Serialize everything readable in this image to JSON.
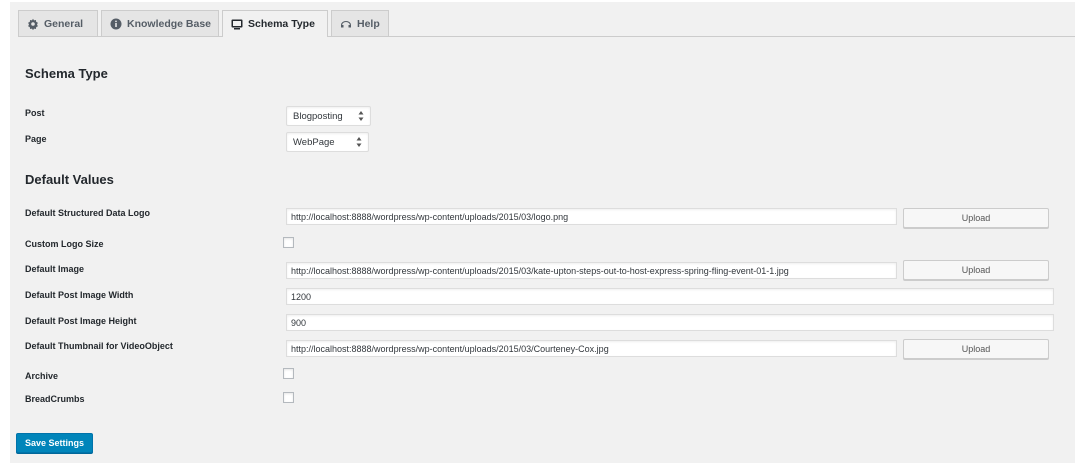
{
  "tabs": [
    {
      "label": "General",
      "icon": "gear-icon"
    },
    {
      "label": "Knowledge Base",
      "icon": "info-icon"
    },
    {
      "label": "Schema Type",
      "icon": "schema-icon"
    },
    {
      "label": "Help",
      "icon": "help-icon"
    }
  ],
  "active_tab": "Schema Type",
  "schema_section": {
    "title": "Schema Type",
    "post_label": "Post",
    "post_value": "Blogposting",
    "page_label": "Page",
    "page_value": "WebPage"
  },
  "defaults_section": {
    "title": "Default Values",
    "logo_label": "Default Structured Data Logo",
    "logo_value": "http://localhost:8888/wordpress/wp-content/uploads/2015/03/logo.png",
    "custom_logo_label": "Custom Logo Size",
    "image_label": "Default Image",
    "image_value": "http://localhost:8888/wordpress/wp-content/uploads/2015/03/kate-upton-steps-out-to-host-express-spring-fling-event-01-1.jpg",
    "width_label": "Default Post Image Width",
    "width_value": "1200",
    "height_label": "Default Post Image Height",
    "height_value": "900",
    "thumbnail_label": "Default Thumbnail for VideoObject",
    "thumbnail_value": "http://localhost:8888/wordpress/wp-content/uploads/2015/03/Courteney-Cox.jpg",
    "archive_label": "Archive",
    "breadcrumbs_label": "BreadCrumbs",
    "upload_label": "Upload"
  },
  "save_label": "Save Settings",
  "colors": {
    "accent": "#0085ba",
    "background": "#f1f1f1"
  }
}
